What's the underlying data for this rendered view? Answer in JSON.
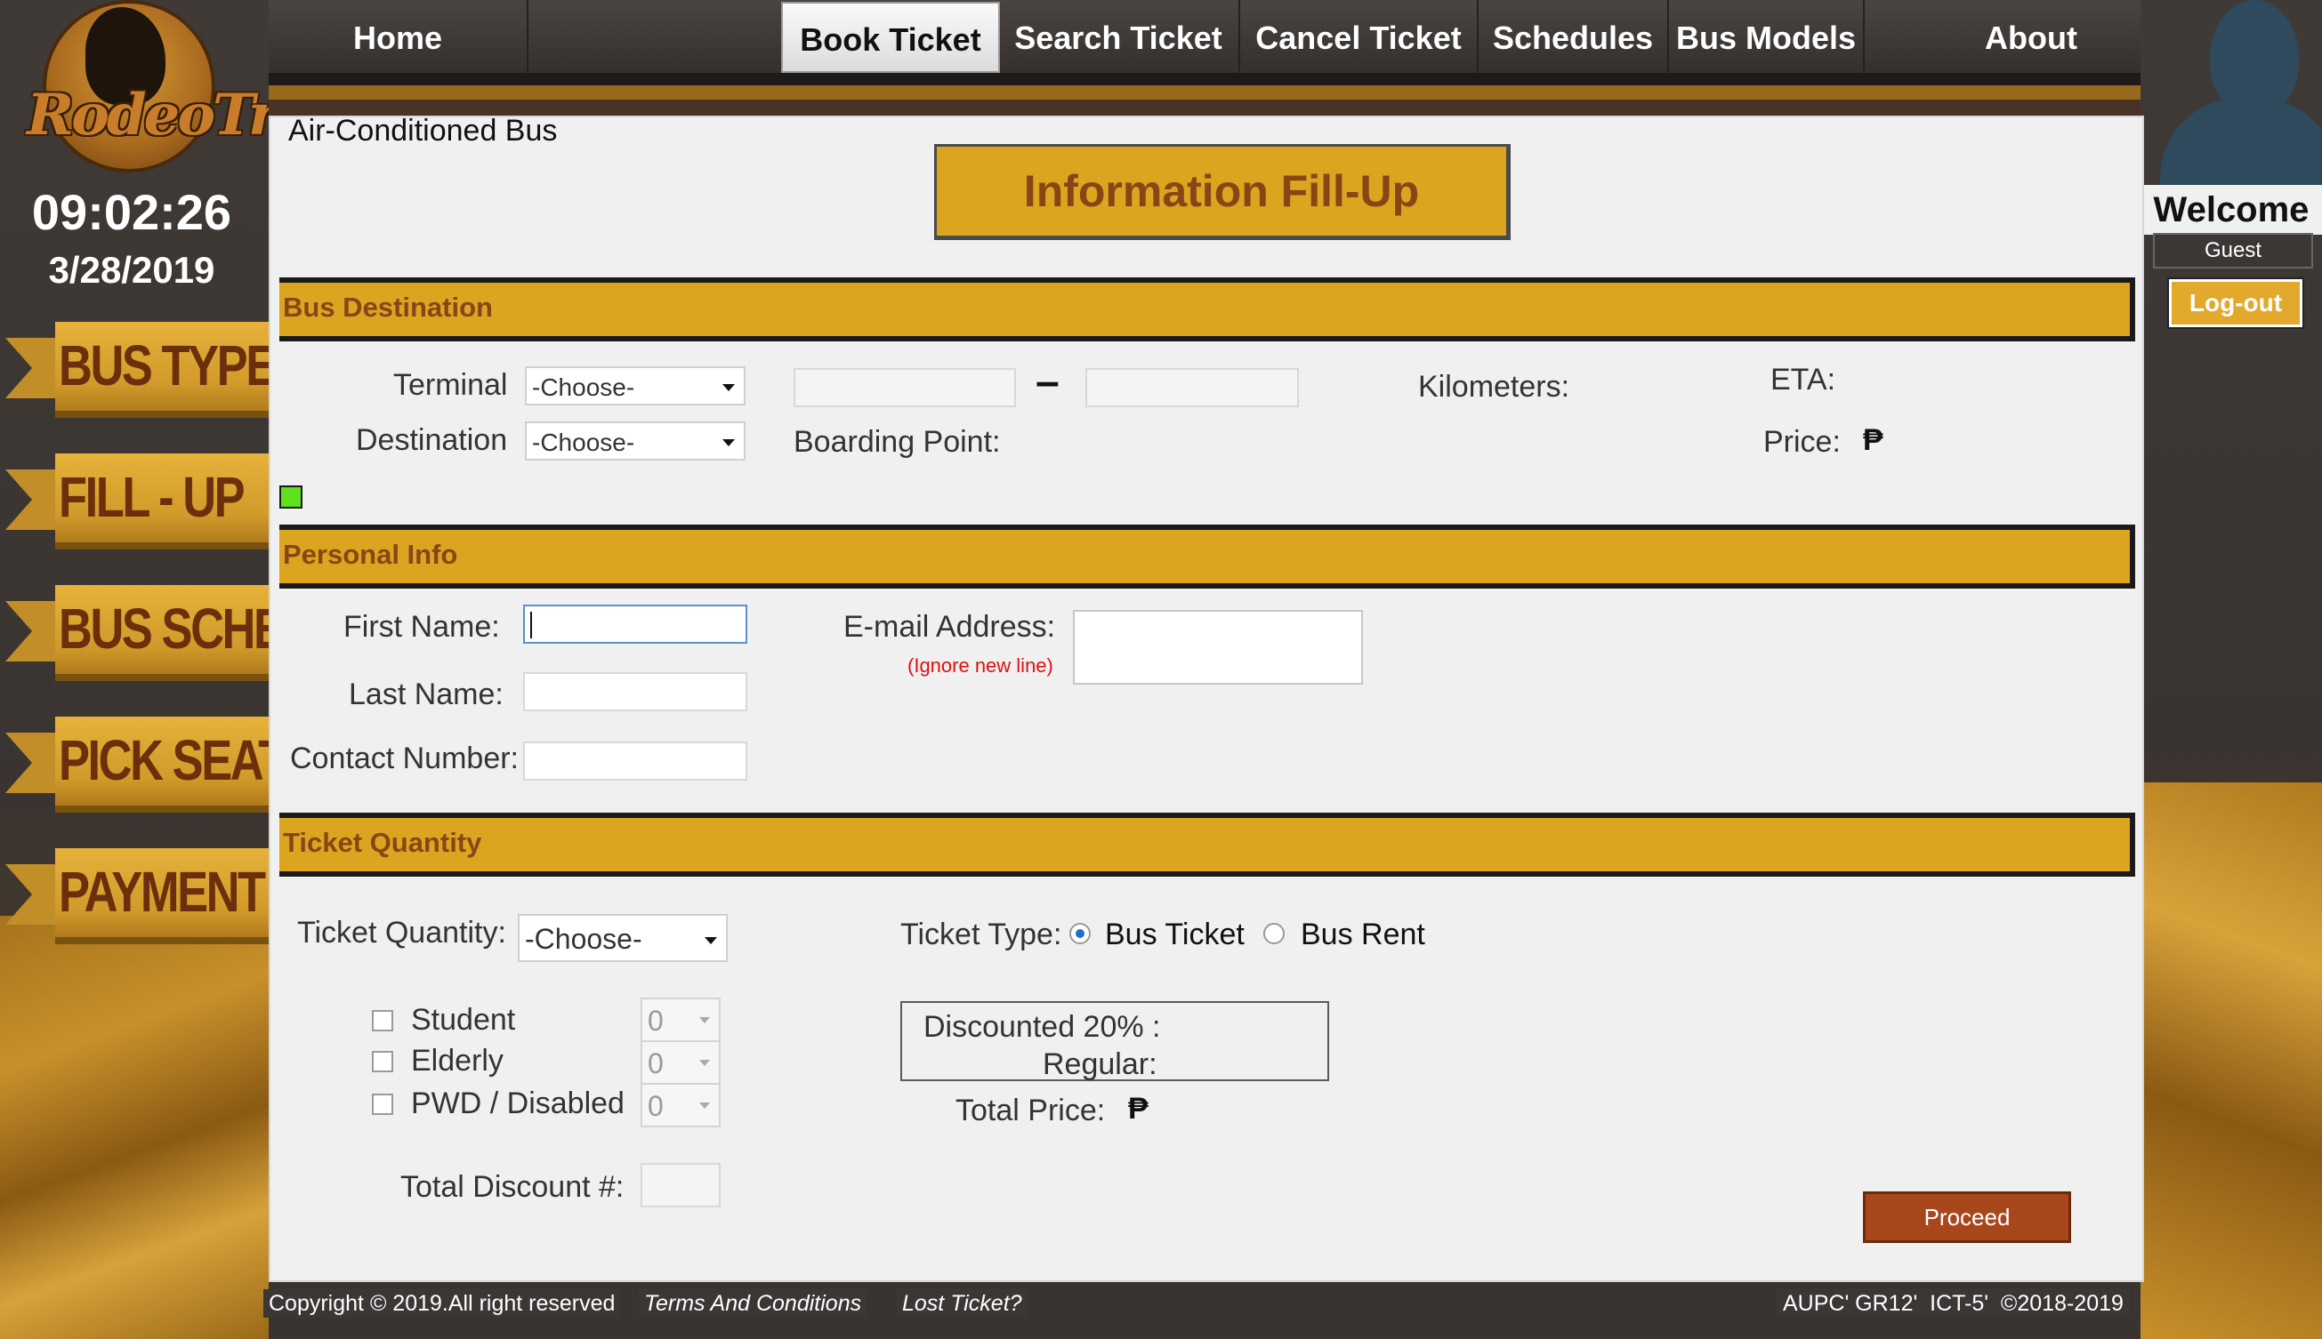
{
  "app": {
    "logo_text": "RodeoTrip",
    "clock": "09:02:26",
    "date": "3/28/2019"
  },
  "steps": [
    "BUS TYPE",
    "FILL - UP",
    "BUS SCHED.",
    "PICK SEATS",
    "PAYMENT"
  ],
  "nav": {
    "items": [
      "Home",
      "Book Ticket",
      "Search Ticket",
      "Cancel Ticket",
      "Schedules",
      "Bus Models",
      "About"
    ],
    "active": "Book Ticket"
  },
  "user": {
    "welcome": "Welcome",
    "name": "Guest",
    "logout": "Log-out"
  },
  "form": {
    "bus_type": "Air-Conditioned Bus",
    "title": "Information Fill-Up",
    "destination_section": {
      "title": "Bus Destination",
      "terminal_label": "Terminal",
      "terminal_value": "-Choose-",
      "destination_label": "Destination",
      "destination_value": "-Choose-",
      "dash": "–",
      "boarding_point_label": "Boarding Point:",
      "kilometers_label": "Kilometers:",
      "eta_label": "ETA:",
      "price_label": "Price:",
      "currency": "₱"
    },
    "personal_section": {
      "title": "Personal Info",
      "first_name_label": "First Name:",
      "last_name_label": "Last Name:",
      "contact_label": "Contact Number:",
      "email_label": "E-mail Address:",
      "email_note": "(Ignore new line)"
    },
    "ticket_section": {
      "title": "Ticket Quantity",
      "quantity_label": "Ticket Quantity:",
      "quantity_value": "-Choose-",
      "type_label": "Ticket Type:",
      "type_options": [
        "Bus Ticket",
        "Bus Rent"
      ],
      "type_selected": "Bus Ticket",
      "discounts": [
        {
          "label": "Student",
          "value": "0",
          "checked": false
        },
        {
          "label": "Elderly",
          "value": "0",
          "checked": false
        },
        {
          "label": "PWD / Disabled",
          "value": "0",
          "checked": false
        }
      ],
      "discounted_label": "Discounted 20% :",
      "regular_label": "Regular:",
      "total_price_label": "Total Price:",
      "currency": "₱",
      "total_discount_label": "Total Discount #:",
      "proceed": "Proceed"
    }
  },
  "footer": {
    "copyright": "Copyright © 2019.All right reserved",
    "terms": "Terms And Conditions",
    "lost": "Lost Ticket?",
    "credits": "AUPC' GR12'  ICT-5'  ©2018-2019"
  },
  "colors": {
    "accent": "#dca51f",
    "accent_text": "#8a4516",
    "proceed": "#a9471c",
    "status_square": "#5ee01c"
  }
}
